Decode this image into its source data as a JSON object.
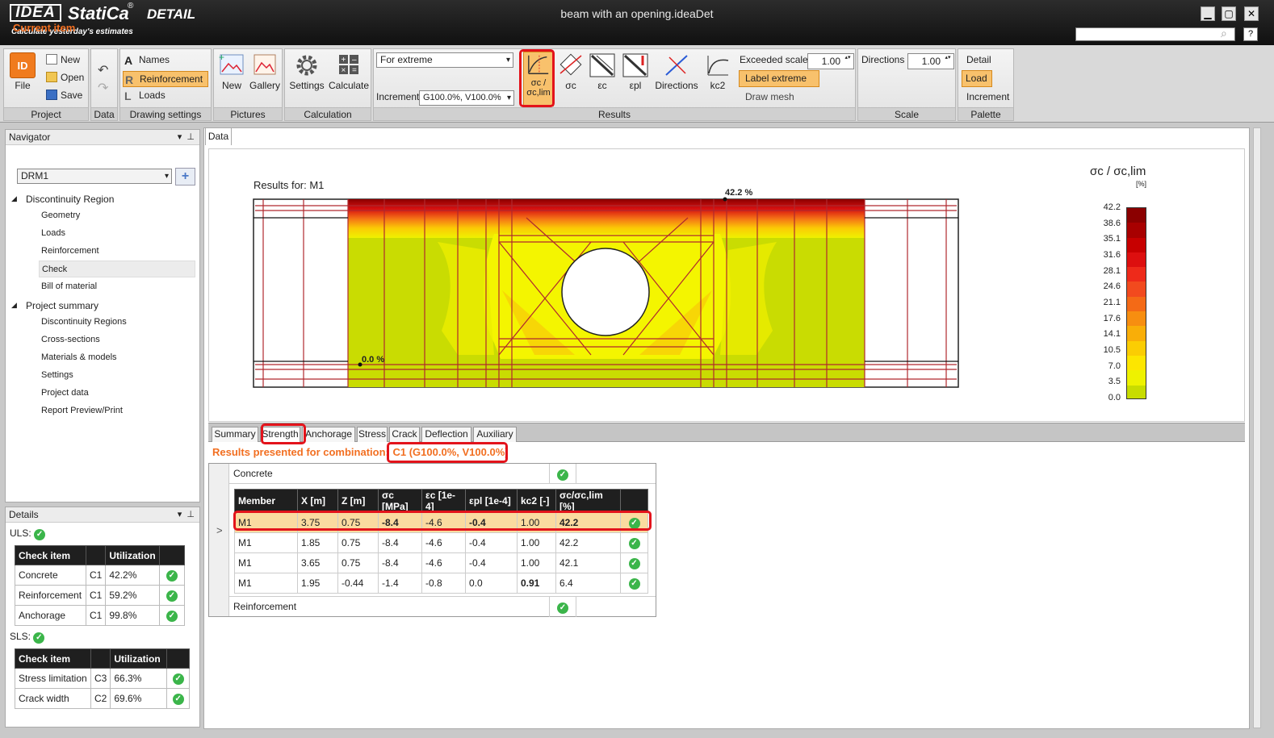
{
  "app": {
    "logo": "IDEA",
    "name": "StatiCa",
    "mark": "®",
    "product": "DETAIL",
    "slogan": "Calculate yesterday's estimates",
    "window_title": "beam with an opening.ideaDet",
    "minimize": "▁",
    "maximize": "▢",
    "close": "✕",
    "help": "?"
  },
  "ribbon": {
    "project": {
      "label": "Project",
      "file": "File",
      "file_logo": "ID",
      "new": "New",
      "open": "Open",
      "save": "Save"
    },
    "data": {
      "label": "Data"
    },
    "drawing": {
      "label": "Drawing settings",
      "names": "Names",
      "reinforcement": "Reinforcement",
      "loads": "Loads"
    },
    "pictures": {
      "label": "Pictures",
      "new": "New",
      "gallery": "Gallery"
    },
    "calculation": {
      "label": "Calculation",
      "settings": "Settings",
      "calculate": "Calculate"
    },
    "results": {
      "label": "Results",
      "combo_value": "For extreme",
      "increment_label": "Increment",
      "increment_value": "G100.0%, V100.0%",
      "sc_ratio_line1": "σc /",
      "sc_ratio_line2": "σc,lim",
      "sc": "σc",
      "ec": "εc",
      "epl": "εpl",
      "directions": "Directions",
      "kc2": "kc2",
      "exceeded_scale_label": "Exceeded scale",
      "exceeded_scale_value": "1.00",
      "label_extreme": "Label extreme",
      "draw_mesh": "Draw mesh"
    },
    "scale": {
      "label": "Scale",
      "directions_label": "Directions",
      "directions_value": "1.00"
    },
    "palette": {
      "label": "Palette",
      "detail": "Detail",
      "load": "Load",
      "increment": "Increment"
    }
  },
  "navigator": {
    "title": "Navigator",
    "current_item": "Current item",
    "selected": "DRM1",
    "add": "+",
    "tree": [
      {
        "label": "Discontinuity Region",
        "children": [
          "Geometry",
          "Loads",
          "Reinforcement",
          "Check",
          "Bill of material"
        ]
      },
      {
        "label": "Project summary",
        "children": [
          "Discontinuity Regions",
          "Cross-sections",
          "Materials & models",
          "Settings",
          "Project data",
          "Report Preview/Print"
        ]
      }
    ],
    "selected_leaf": "Check"
  },
  "details": {
    "title": "Details",
    "uls": "ULS:",
    "sls": "SLS:",
    "headers": [
      "Check item",
      "",
      "Utilization",
      ""
    ],
    "uls_rows": [
      {
        "item": "Concrete",
        "comb": "C1",
        "util": "42.2%"
      },
      {
        "item": "Reinforcement",
        "comb": "C1",
        "util": "59.2%"
      },
      {
        "item": "Anchorage",
        "comb": "C1",
        "util": "99.8%"
      }
    ],
    "sls_rows": [
      {
        "item": "Stress limitation",
        "comb": "C3",
        "util": "66.3%"
      },
      {
        "item": "Crack width",
        "comb": "C2",
        "util": "69.6%"
      }
    ]
  },
  "main": {
    "tab": "Data",
    "results_for": "Results for: M1",
    "max_label": "42.2 %",
    "min_label": "0.0 %",
    "legend_title": "σc / σc,lim",
    "legend_unit": "[%]",
    "legend_ticks": [
      "42.2",
      "38.6",
      "35.1",
      "31.6",
      "28.1",
      "24.6",
      "21.1",
      "17.6",
      "14.1",
      "10.5",
      "7.0",
      "3.5",
      "0.0"
    ],
    "legend_colors": [
      "#8b0000",
      "#a80000",
      "#c70000",
      "#dd0f0f",
      "#ee2a1a",
      "#f24a1e",
      "#f46a16",
      "#f78e10",
      "#f9ae08",
      "#fbcd03",
      "#fde600",
      "#eef200",
      "#c8dc00"
    ],
    "result_tabs": [
      "Summary",
      "Strength",
      "Anchorage",
      "Stress",
      "Crack",
      "Deflection",
      "Auxiliary"
    ],
    "active_tab": "Strength",
    "combo_prefix": "Results presented for combination:",
    "combo_value": "C1 (G100.0%, V100.0%)"
  },
  "results_table": {
    "concrete_label": "Concrete",
    "reinforcement_label": "Reinforcement",
    "expander": ">",
    "headers": [
      "Member",
      "X [m]",
      "Z [m]",
      "σc [MPa]",
      "εc [1e-4]",
      "εpl [1e-4]",
      "kc2 [-]",
      "σc/σc,lim [%]",
      ""
    ],
    "rows": [
      [
        "M1",
        "3.75",
        "0.75",
        "-8.4",
        "-4.6",
        "-0.4",
        "1.00",
        "42.2"
      ],
      [
        "M1",
        "1.85",
        "0.75",
        "-8.4",
        "-4.6",
        "-0.4",
        "1.00",
        "42.2"
      ],
      [
        "M1",
        "3.65",
        "0.75",
        "-8.4",
        "-4.6",
        "-0.4",
        "1.00",
        "42.1"
      ],
      [
        "M1",
        "1.95",
        "-0.44",
        "-1.4",
        "-0.8",
        "0.0",
        "0.91",
        "6.4"
      ]
    ]
  },
  "colors": {
    "accent": "#f26f21",
    "highlight": "#e3131b",
    "ok": "#3bb54a"
  }
}
